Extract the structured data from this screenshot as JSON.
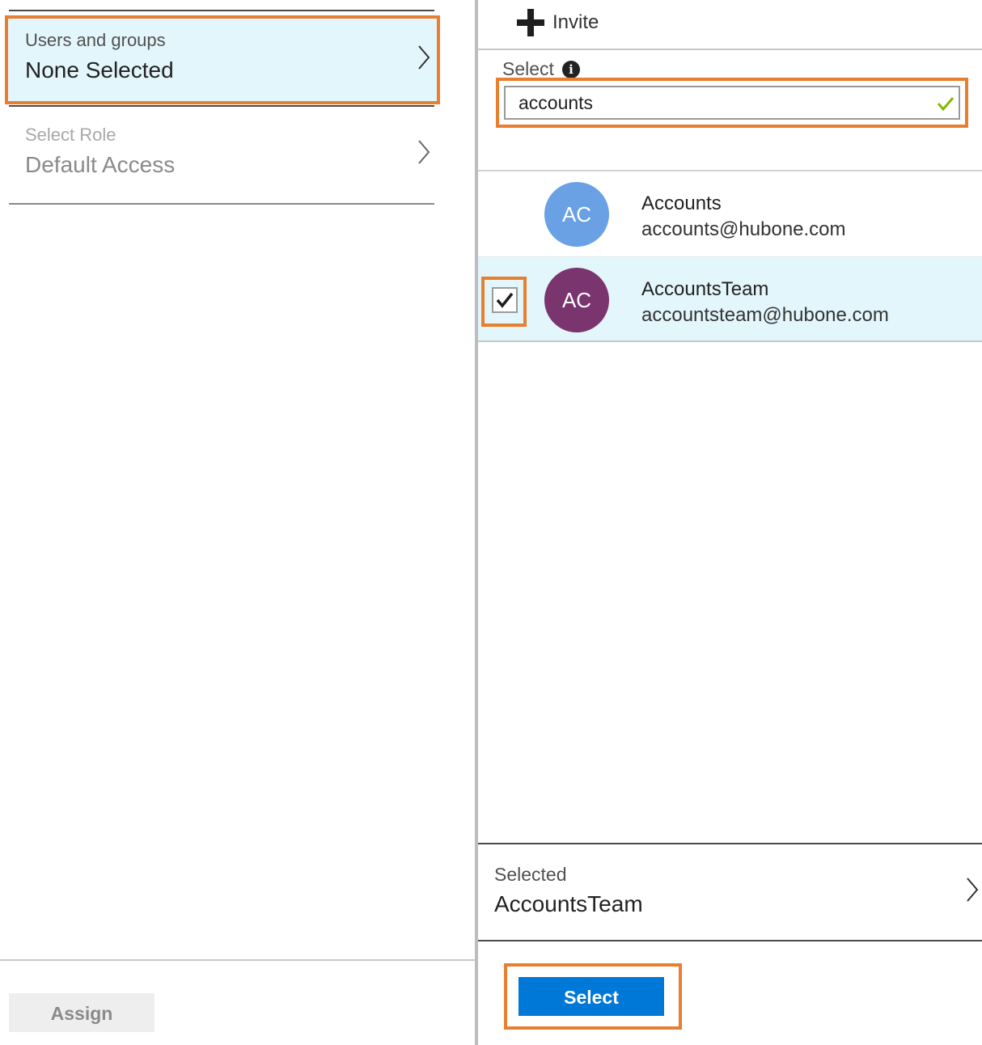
{
  "assign_panel": {
    "users_and_groups": {
      "label": "Users and groups",
      "value": "None Selected"
    },
    "select_role": {
      "label": "Select Role",
      "value": "Default Access"
    },
    "assign_label": "Assign"
  },
  "picker_panel": {
    "invite_label": "Invite",
    "search": {
      "label": "Select",
      "value": "accounts"
    },
    "results": [
      {
        "initials": "AC",
        "name": "Accounts",
        "email": "accounts@hubone.com",
        "avatar_color": "#69a1e4",
        "checked": false
      },
      {
        "initials": "AC",
        "name": "AccountsTeam",
        "email": "accountsteam@hubone.com",
        "avatar_color": "#7a356e",
        "checked": true
      }
    ],
    "selected": {
      "label": "Selected",
      "value": "AccountsTeam"
    },
    "select_button_label": "Select"
  },
  "colors": {
    "highlight_outline": "#e87f30",
    "selected_row_bg": "#e3f6fc",
    "primary_button": "#0078d7",
    "valid_check": "#7fba00"
  }
}
